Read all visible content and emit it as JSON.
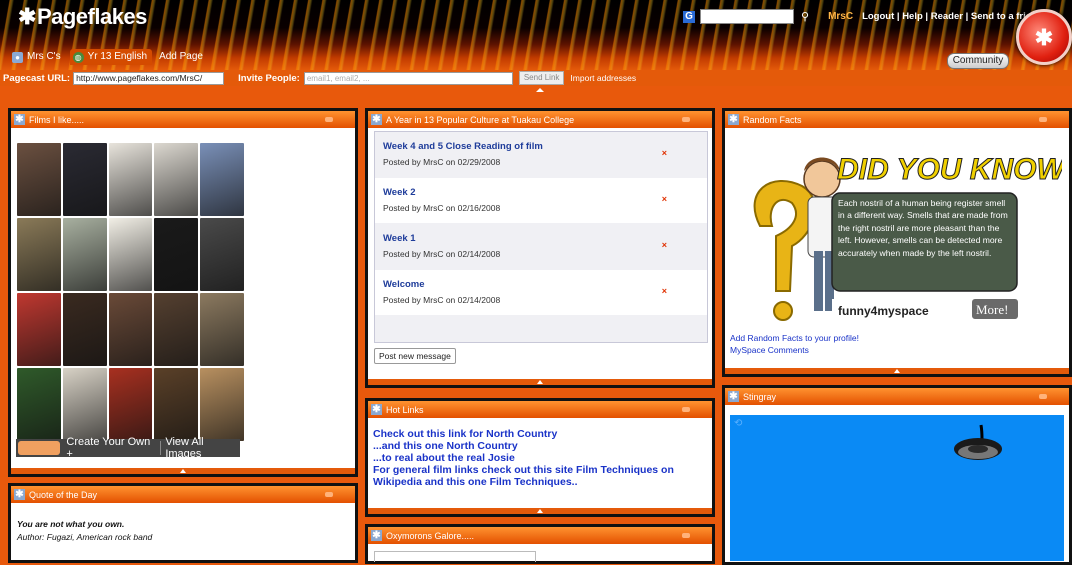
{
  "header": {
    "logo": "Pageflakes",
    "tabs": [
      {
        "label": "Mrs C's",
        "icon": "person-icon"
      },
      {
        "label": "Yr 13 English",
        "icon": "globe-icon"
      },
      {
        "label": "Add Page",
        "icon": ""
      }
    ],
    "search_placeholder": "",
    "username": "MrsC",
    "links": "Logout | Help | Reader | Send to a friend",
    "community": "Community"
  },
  "urlbar": {
    "pagecast_label": "Pagecast URL:",
    "pagecast_url": "http://www.pageflakes.com/MrsC/",
    "invite_label": "Invite People:",
    "invite_placeholder": "email1, email2, ...",
    "send_link": "Send Link",
    "import": "Import addresses"
  },
  "films": {
    "title": "Films I like.....",
    "create_label": "Create Your Own +",
    "view_label": "View All Images",
    "poster_colors": [
      "#6b5040",
      "#2a2a33",
      "#e8e4dc",
      "#dcd8d0",
      "#7a90b8",
      "#8a7a58",
      "#a8b0a0",
      "#f2efe6",
      "#1a1a1a",
      "#4a4a4a",
      "#c03830",
      "#3a2a20",
      "#6a4a38",
      "#554030",
      "#8c7a60",
      "#2f5a2a",
      "#d8d2c6",
      "#a83020",
      "#5a4028",
      "#b89060"
    ]
  },
  "culture": {
    "title": "A Year in 13 Popular Culture at Tuakau College",
    "posts": [
      {
        "title": "Week 4 and 5 Close Reading of film",
        "byline": "Posted by MrsC on 02/29/2008"
      },
      {
        "title": "Week 2",
        "byline": "Posted by MrsC on 02/16/2008"
      },
      {
        "title": "Week 1",
        "byline": "Posted by MrsC on 02/14/2008"
      },
      {
        "title": "Welcome",
        "byline": "Posted by MrsC on 02/14/2008"
      }
    ],
    "delete_glyph": "×",
    "post_new": "Post new message"
  },
  "hotlinks": {
    "title": "Hot Links",
    "lines": [
      "Check out this link for North Country",
      "...and this one North Country",
      "...to real about the real Josie",
      "For general film links check out this site Film Techniques on Wikipedia and this one Film Techniques.."
    ]
  },
  "quote": {
    "title": "Quote of the Day",
    "text": "You are not what you own.",
    "author": "Author: Fugazi, American rock band"
  },
  "oxymorons": {
    "title": "Oxymorons Galore....."
  },
  "facts": {
    "title": "Random Facts",
    "headline": "DID YOU KNOW ?",
    "fact": "Each nostril of a human being register smell in a different way. Smells that are made from the right nostril are more pleasant than the left. However, smells can be detected more accurately when made by the left nostril.",
    "brand": "funny4myspace",
    "more": "More!",
    "link1": "Add Random Facts to your profile!",
    "link2": "MySpace Comments"
  },
  "stingray": {
    "title": "Stingray"
  }
}
